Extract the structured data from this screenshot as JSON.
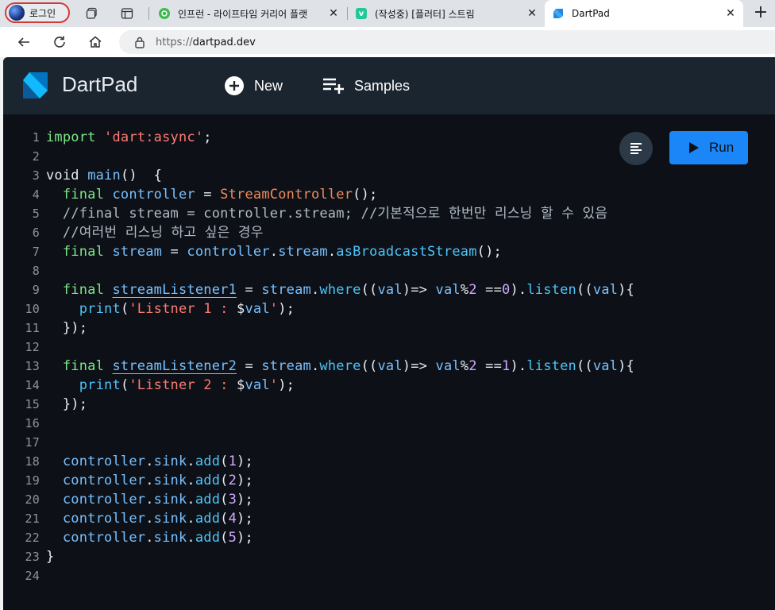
{
  "browser": {
    "profile_label": "로그인",
    "tabs": [
      {
        "title": "인프런 - 라이프타임 커리어 플랫",
        "icon": "inflearn-icon",
        "color": "#3fb950",
        "active": false
      },
      {
        "title": "(작성중) [플러터] 스트림",
        "icon": "velog-icon",
        "color": "#20c997",
        "active": false
      },
      {
        "title": "DartPad",
        "icon": "dart-icon",
        "color": "#1e88e5",
        "active": true
      }
    ],
    "url_scheme": "https://",
    "url_host": "dartpad.dev"
  },
  "app": {
    "brand": "DartPad",
    "new_label": "New",
    "samples_label": "Samples",
    "run_label": "Run",
    "colors": {
      "header": "#1b2530",
      "editor": "#0d1117",
      "run": "#1a86f7"
    }
  },
  "code": {
    "lines": [
      {
        "n": "1",
        "tokens": [
          [
            "kw",
            "import"
          ],
          [
            "pl",
            " "
          ],
          [
            "str",
            "'dart:async'"
          ],
          [
            "pl",
            ";"
          ]
        ]
      },
      {
        "n": "2",
        "tokens": []
      },
      {
        "n": "3",
        "tokens": [
          [
            "pl",
            "void "
          ],
          [
            "id",
            "main"
          ],
          [
            "pl",
            "()  {"
          ]
        ]
      },
      {
        "n": "4",
        "tokens": [
          [
            "pl",
            "  "
          ],
          [
            "kw",
            "final"
          ],
          [
            "pl",
            " "
          ],
          [
            "id",
            "controller"
          ],
          [
            "pl",
            " = "
          ],
          [
            "cls",
            "StreamController"
          ],
          [
            "pl",
            "();"
          ]
        ]
      },
      {
        "n": "5",
        "tokens": [
          [
            "cm",
            "  //final stream = controller.stream; //기본적으로 한번만 리스닝 할 수 있음"
          ]
        ]
      },
      {
        "n": "6",
        "tokens": [
          [
            "cm",
            "  //여러번 리스닝 하고 싶은 경우"
          ]
        ]
      },
      {
        "n": "7",
        "tokens": [
          [
            "pl",
            "  "
          ],
          [
            "kw",
            "final"
          ],
          [
            "pl",
            " "
          ],
          [
            "id",
            "stream"
          ],
          [
            "pl",
            " = "
          ],
          [
            "id",
            "controller"
          ],
          [
            "pl",
            "."
          ],
          [
            "id",
            "stream"
          ],
          [
            "pl",
            "."
          ],
          [
            "fn",
            "asBroadcastStream"
          ],
          [
            "pl",
            "();"
          ]
        ]
      },
      {
        "n": "8",
        "tokens": []
      },
      {
        "n": "9",
        "tokens": [
          [
            "pl",
            "  "
          ],
          [
            "kw",
            "final"
          ],
          [
            "pl",
            " "
          ],
          [
            "id ul",
            "streamListener1"
          ],
          [
            "pl",
            " = "
          ],
          [
            "id",
            "stream"
          ],
          [
            "pl",
            "."
          ],
          [
            "fn",
            "where"
          ],
          [
            "pl",
            "(("
          ],
          [
            "id",
            "val"
          ],
          [
            "pl",
            ")=> "
          ],
          [
            "id",
            "val"
          ],
          [
            "pl",
            "%"
          ],
          [
            "num",
            "2"
          ],
          [
            "pl",
            " =="
          ],
          [
            "num",
            "0"
          ],
          [
            "pl",
            ")."
          ],
          [
            "fn",
            "listen"
          ],
          [
            "pl",
            "(("
          ],
          [
            "id",
            "val"
          ],
          [
            "pl",
            "){"
          ]
        ]
      },
      {
        "n": "10",
        "tokens": [
          [
            "pl",
            "    "
          ],
          [
            "fn",
            "print"
          ],
          [
            "pl",
            "("
          ],
          [
            "str",
            "'Listner 1 : "
          ],
          [
            "pl",
            "$"
          ],
          [
            "id",
            "val"
          ],
          [
            "str",
            "'"
          ],
          [
            "pl",
            ");"
          ]
        ]
      },
      {
        "n": "11",
        "tokens": [
          [
            "pl",
            "  });"
          ]
        ]
      },
      {
        "n": "12",
        "tokens": []
      },
      {
        "n": "13",
        "tokens": [
          [
            "pl",
            "  "
          ],
          [
            "kw",
            "final"
          ],
          [
            "pl",
            " "
          ],
          [
            "id ul",
            "streamListener2"
          ],
          [
            "pl",
            " = "
          ],
          [
            "id",
            "stream"
          ],
          [
            "pl",
            "."
          ],
          [
            "fn",
            "where"
          ],
          [
            "pl",
            "(("
          ],
          [
            "id",
            "val"
          ],
          [
            "pl",
            ")=> "
          ],
          [
            "id",
            "val"
          ],
          [
            "pl",
            "%"
          ],
          [
            "num",
            "2"
          ],
          [
            "pl",
            " =="
          ],
          [
            "num",
            "1"
          ],
          [
            "pl",
            ")."
          ],
          [
            "fn",
            "listen"
          ],
          [
            "pl",
            "(("
          ],
          [
            "id",
            "val"
          ],
          [
            "pl",
            "){"
          ]
        ]
      },
      {
        "n": "14",
        "tokens": [
          [
            "pl",
            "    "
          ],
          [
            "fn",
            "print"
          ],
          [
            "pl",
            "("
          ],
          [
            "str",
            "'Listner 2 : "
          ],
          [
            "pl",
            "$"
          ],
          [
            "id",
            "val"
          ],
          [
            "str",
            "'"
          ],
          [
            "pl",
            ");"
          ]
        ]
      },
      {
        "n": "15",
        "tokens": [
          [
            "pl",
            "  });"
          ]
        ]
      },
      {
        "n": "16",
        "tokens": []
      },
      {
        "n": "17",
        "tokens": []
      },
      {
        "n": "18",
        "tokens": [
          [
            "pl",
            "  "
          ],
          [
            "id",
            "controller"
          ],
          [
            "pl",
            "."
          ],
          [
            "id",
            "sink"
          ],
          [
            "pl",
            "."
          ],
          [
            "fn",
            "add"
          ],
          [
            "pl",
            "("
          ],
          [
            "num",
            "1"
          ],
          [
            "pl",
            ");"
          ]
        ]
      },
      {
        "n": "19",
        "tokens": [
          [
            "pl",
            "  "
          ],
          [
            "id",
            "controller"
          ],
          [
            "pl",
            "."
          ],
          [
            "id",
            "sink"
          ],
          [
            "pl",
            "."
          ],
          [
            "fn",
            "add"
          ],
          [
            "pl",
            "("
          ],
          [
            "num",
            "2"
          ],
          [
            "pl",
            ");"
          ]
        ]
      },
      {
        "n": "20",
        "tokens": [
          [
            "pl",
            "  "
          ],
          [
            "id",
            "controller"
          ],
          [
            "pl",
            "."
          ],
          [
            "id",
            "sink"
          ],
          [
            "pl",
            "."
          ],
          [
            "fn",
            "add"
          ],
          [
            "pl",
            "("
          ],
          [
            "num",
            "3"
          ],
          [
            "pl",
            ");"
          ]
        ]
      },
      {
        "n": "21",
        "tokens": [
          [
            "pl",
            "  "
          ],
          [
            "id",
            "controller"
          ],
          [
            "pl",
            "."
          ],
          [
            "id",
            "sink"
          ],
          [
            "pl",
            "."
          ],
          [
            "fn",
            "add"
          ],
          [
            "pl",
            "("
          ],
          [
            "num",
            "4"
          ],
          [
            "pl",
            ");"
          ]
        ]
      },
      {
        "n": "22",
        "tokens": [
          [
            "pl",
            "  "
          ],
          [
            "id",
            "controller"
          ],
          [
            "pl",
            "."
          ],
          [
            "id",
            "sink"
          ],
          [
            "pl",
            "."
          ],
          [
            "fn",
            "add"
          ],
          [
            "pl",
            "("
          ],
          [
            "num",
            "5"
          ],
          [
            "pl",
            ");"
          ]
        ]
      },
      {
        "n": "23",
        "tokens": [
          [
            "pl",
            "}"
          ]
        ]
      },
      {
        "n": "24",
        "tokens": []
      }
    ]
  }
}
